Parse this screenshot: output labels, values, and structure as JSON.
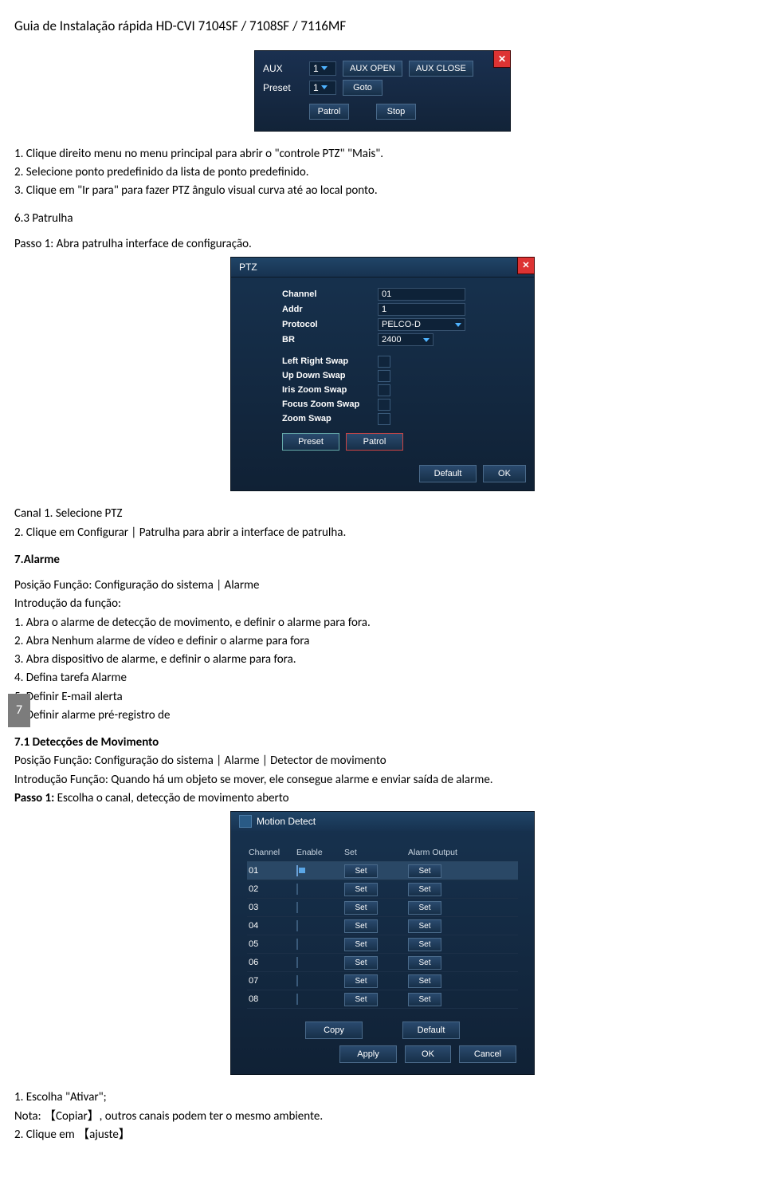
{
  "doc_title": "Guia de Instalação rápida HD-CVI 7104SF / 7108SF / 7116MF",
  "panel1": {
    "aux_label": "AUX",
    "aux_value": "1",
    "aux_open": "AUX OPEN",
    "aux_close": "AUX CLOSE",
    "preset_label": "Preset",
    "preset_value": "1",
    "goto": "Goto",
    "patrol": "Patrol",
    "stop": "Stop"
  },
  "steps1": {
    "l1": "1. Clique direito menu no menu principal para abrir o \"controle PTZ\" \"Mais\".",
    "l2": "2. Selecione ponto predefinido da lista de ponto predefinido.",
    "l3": "3. Clique em \"Ir para\" para fazer PTZ ângulo visual curva até ao local ponto."
  },
  "sect63_title": "6.3 Patrulha",
  "sect63_p1": "Passo 1: Abra patrulha interface de configuração.",
  "panel2": {
    "title": "PTZ",
    "channel_l": "Channel",
    "channel_v": "01",
    "addr_l": "Addr",
    "addr_v": "1",
    "proto_l": "Protocol",
    "proto_v": "PELCO-D",
    "br_l": "BR",
    "br_v": "2400",
    "lr": "Left Right Swap",
    "ud": "Up Down Swap",
    "iz": "Iris Zoom Swap",
    "fz": "Focus Zoom Swap",
    "zs": "Zoom Swap",
    "preset": "Preset",
    "patrol": "Patrol",
    "default": "Default",
    "ok": "OK"
  },
  "after_p2": {
    "l1": "Canal 1. Selecione PTZ",
    "l2": "2. Clique em Configurar | Patrulha para abrir a interface de patrulha."
  },
  "page_number": "7",
  "sect7_title": "7.Alarme",
  "sect7": {
    "pos": "Posição Função: Configuração do sistema | Alarme",
    "intro": "Introdução da função:",
    "l1": "1. Abra o alarme de detecção de movimento, e definir o alarme para fora.",
    "l2": "2. Abra Nenhum alarme de vídeo e definir o alarme para fora",
    "l3": "3. Abra dispositivo de alarme, e definir o alarme para fora.",
    "l4": "4. Defina tarefa Alarme",
    "l5": "5. Definir E-mail alerta",
    "l6": "6. Definir alarme pré-registro de"
  },
  "sect71_title": "7.1 Detecções de Movimento",
  "sect71": {
    "pos": "Posição Função: Configuração do sistema | Alarme | Detector de movimento",
    "intro": "Introdução Função: Quando há um objeto se mover, ele consegue alarme e enviar saída de alarme.",
    "step1p": "Passo 1:",
    "step1t": " Escolha o canal, detecção de movimento aberto"
  },
  "panel3": {
    "title": "Motion Detect",
    "h_channel": "Channel",
    "h_enable": "Enable",
    "h_set": "Set",
    "h_alarm": "Alarm Output",
    "set": "Set",
    "copy": "Copy",
    "default": "Default",
    "apply": "Apply",
    "ok": "OK",
    "cancel": "Cancel",
    "rows": [
      {
        "ch": "01",
        "on": true
      },
      {
        "ch": "02",
        "on": false
      },
      {
        "ch": "03",
        "on": false
      },
      {
        "ch": "04",
        "on": false
      },
      {
        "ch": "05",
        "on": false
      },
      {
        "ch": "06",
        "on": false
      },
      {
        "ch": "07",
        "on": false
      },
      {
        "ch": "08",
        "on": false
      }
    ]
  },
  "tail": {
    "l1": "1. Escolha \"Ativar\";",
    "l2a": "Nota: 【Copiar】, outros canais podem ter o mesmo ambiente.",
    "l3": "2. Clique em 【ajuste】"
  }
}
